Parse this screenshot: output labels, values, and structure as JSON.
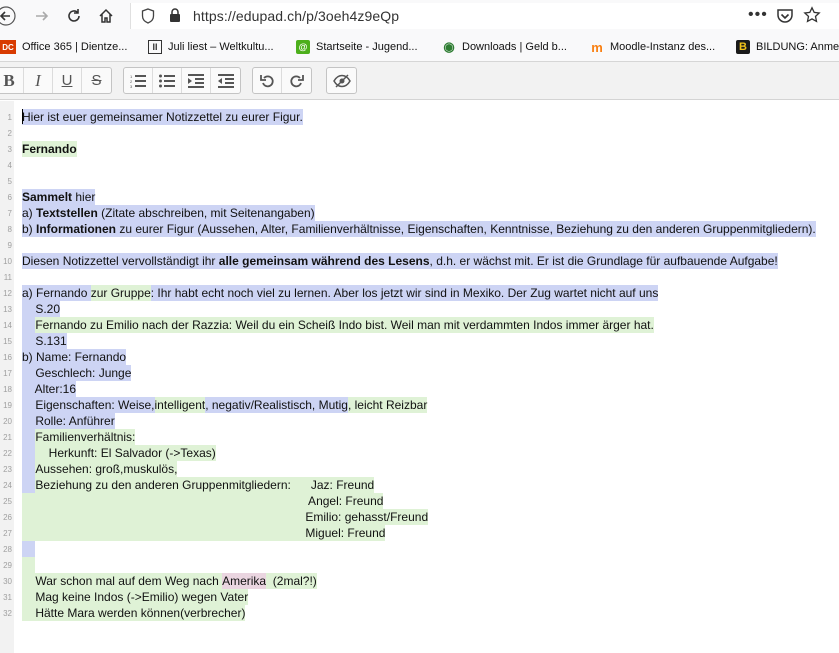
{
  "browser": {
    "url": "https://edupad.ch/p/3oeh4z9eQp",
    "bookmarks": [
      {
        "label": "Office 365 | Dientze...",
        "icon_glyph": "DC",
        "color": "#d83b01"
      },
      {
        "label": "Juli liest – Weltkultu...",
        "icon_glyph": "II",
        "color": "#333333"
      },
      {
        "label": "Startseite - Jugend...",
        "icon_glyph": "@",
        "color": "#4caf1b"
      },
      {
        "label": "Downloads | Geld b...",
        "icon_glyph": "◉",
        "color": "#2e7d32"
      },
      {
        "label": "Moodle-Instanz des...",
        "icon_glyph": "m",
        "color": "#f98012"
      },
      {
        "label": "BILDUNG: Anme",
        "icon_glyph": "B",
        "color": "#c79a1a"
      }
    ]
  },
  "editor": {
    "lines": [
      {
        "num": "1",
        "indent": 0,
        "segs": [
          {
            "t": "Hier ist euer gemeinsamer Notizzettel zu eurer Figur.",
            "c": "a"
          }
        ]
      },
      {
        "num": "2",
        "indent": 0,
        "segs": []
      },
      {
        "num": "3",
        "indent": 0,
        "segs": [
          {
            "t": "Fernando",
            "c": "g",
            "b": true
          }
        ]
      },
      {
        "num": "4",
        "indent": 0,
        "segs": []
      },
      {
        "num": "5",
        "indent": 0,
        "segs": []
      },
      {
        "num": "6",
        "indent": 0,
        "segs": [
          {
            "t": "Sammelt",
            "c": "a",
            "b": true
          },
          {
            "t": " hier",
            "c": "a"
          }
        ]
      },
      {
        "num": "7",
        "indent": 0,
        "segs": [
          {
            "t": "a) ",
            "c": "a"
          },
          {
            "t": "Textstellen",
            "c": "a",
            "b": true
          },
          {
            "t": " (Zitate abschreiben, mit Seitenangaben)",
            "c": "a"
          }
        ]
      },
      {
        "num": "8",
        "indent": 0,
        "segs": [
          {
            "t": "b) ",
            "c": "a"
          },
          {
            "t": "Informationen",
            "c": "a",
            "b": true
          },
          {
            "t": " zu eurer Figur (Aussehen, Alter, Familienverhältnisse, Eigenschaften, Kenntnisse, Beziehung zu den anderen Gruppenmitgliedern).",
            "c": "a"
          }
        ]
      },
      {
        "num": "9",
        "indent": 0,
        "segs": []
      },
      {
        "num": "10",
        "indent": 0,
        "segs": [
          {
            "t": "Diesen Notizzettel vervollständigt ihr ",
            "c": "a"
          },
          {
            "t": "alle gemeinsam während des Lesens",
            "c": "a",
            "b": true
          },
          {
            "t": ", d.h. er wächst mit. Er ist die Grundlage für aufbauende Aufgabe!",
            "c": "a"
          }
        ]
      },
      {
        "num": "11",
        "indent": 0,
        "segs": []
      },
      {
        "num": "12",
        "indent": 0,
        "segs": [
          {
            "t": "a) Fernando ",
            "c": "a"
          },
          {
            "t": "zur Gruppe",
            "c": "g"
          },
          {
            "t": ": Ihr habt echt noch viel zu lernen. Aber los jetzt wir sind in Mexiko. Der Zug wartet nicht auf uns",
            "c": "a"
          }
        ]
      },
      {
        "num": "13",
        "indent": 0,
        "segs": [
          {
            "t": "    S.20",
            "c": "a"
          }
        ]
      },
      {
        "num": "14",
        "indent": 0,
        "segs": [
          {
            "t": "    ",
            "c": "a"
          },
          {
            "t": "Fernando zu Emilio nach der Razzia: Weil du ein Scheiß Indo bist. Weil man mit verdammten Indos immer ärger hat.",
            "c": "g"
          }
        ]
      },
      {
        "num": "15",
        "indent": 0,
        "segs": [
          {
            "t": "    S.131",
            "c": "a"
          }
        ]
      },
      {
        "num": "16",
        "indent": 0,
        "segs": [
          {
            "t": "b) Name: Fernando",
            "c": "a"
          }
        ]
      },
      {
        "num": "17",
        "indent": 0,
        "segs": [
          {
            "t": "    Geschlech: Junge",
            "c": "a"
          }
        ]
      },
      {
        "num": "18",
        "indent": 0,
        "segs": [
          {
            "t": "    Alter:16",
            "c": "a"
          }
        ]
      },
      {
        "num": "19",
        "indent": 0,
        "segs": [
          {
            "t": "    Eigenschaften: Weise,",
            "c": "a"
          },
          {
            "t": "intelligent",
            "c": "g"
          },
          {
            "t": ", negativ/Realistisch, Mutig",
            "c": "a"
          },
          {
            "t": ", leicht Reizbar",
            "c": "g"
          }
        ]
      },
      {
        "num": "20",
        "indent": 0,
        "segs": [
          {
            "t": "    Rolle: Anführer",
            "c": "a"
          }
        ]
      },
      {
        "num": "21",
        "indent": 0,
        "segs": [
          {
            "t": "    ",
            "c": "a"
          },
          {
            "t": "Familienverhältnis:",
            "c": "g"
          }
        ]
      },
      {
        "num": "22",
        "indent": 0,
        "segs": [
          {
            "t": "    ",
            "c": "a"
          },
          {
            "t": "    Herkunft: El Salvador (->Texas)",
            "c": "g"
          }
        ]
      },
      {
        "num": "23",
        "indent": 0,
        "segs": [
          {
            "t": "    ",
            "c": "a"
          },
          {
            "t": "Aussehen: groß,muskulös,",
            "c": "g"
          }
        ]
      },
      {
        "num": "24",
        "indent": 0,
        "segs": [
          {
            "t": "    ",
            "c": "a"
          },
          {
            "t": "Beziehung zu den anderen Gruppenmitgliedern:      Jaz: Freund",
            "c": "g"
          }
        ]
      },
      {
        "num": "25",
        "indent": 0,
        "segs": [
          {
            "t": "                                                                                      Angel: Freund",
            "c": "g"
          }
        ]
      },
      {
        "num": "26",
        "indent": 0,
        "segs": [
          {
            "t": "                                                                                     Emilio: gehasst/Freund",
            "c": "g"
          }
        ]
      },
      {
        "num": "27",
        "indent": 0,
        "segs": [
          {
            "t": "                                                                                     Miguel: Freund",
            "c": "g"
          }
        ]
      },
      {
        "num": "28",
        "indent": 0,
        "segs": [
          {
            "t": "    ",
            "c": "a"
          }
        ]
      },
      {
        "num": "29",
        "indent": 0,
        "segs": [
          {
            "t": "    ",
            "c": "g"
          }
        ]
      },
      {
        "num": "30",
        "indent": 0,
        "segs": [
          {
            "t": "    War schon mal auf dem Weg nach ",
            "c": "g"
          },
          {
            "t": "Amerika",
            "c": "p"
          },
          {
            "t": "  (2mal?!)",
            "c": "g"
          }
        ]
      },
      {
        "num": "31",
        "indent": 0,
        "segs": [
          {
            "t": "    Mag keine Indos (->Emilio) wegen Vater",
            "c": "g"
          }
        ]
      },
      {
        "num": "32",
        "indent": 0,
        "segs": [
          {
            "t": "    Hätte Mara werden können(verbrecher)",
            "c": "g"
          }
        ]
      }
    ]
  }
}
